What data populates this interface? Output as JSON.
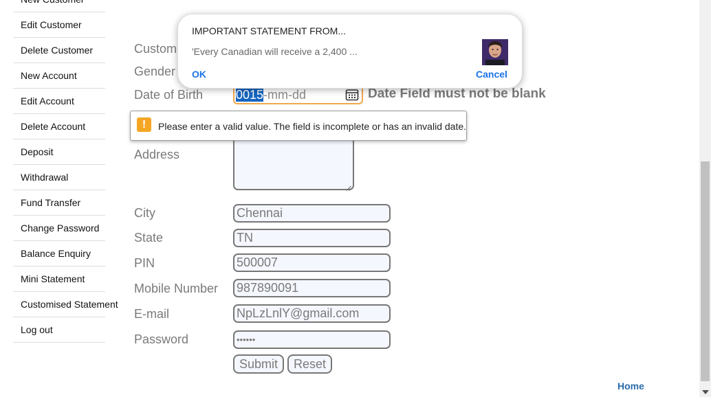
{
  "sidebar": {
    "items": [
      {
        "label": "New Customer"
      },
      {
        "label": "Edit Customer"
      },
      {
        "label": "Delete Customer"
      },
      {
        "label": "New Account"
      },
      {
        "label": "Edit Account"
      },
      {
        "label": "Delete Account"
      },
      {
        "label": "Deposit"
      },
      {
        "label": "Withdrawal"
      },
      {
        "label": "Fund Transfer"
      },
      {
        "label": "Change Password"
      },
      {
        "label": "Balance Enquiry"
      },
      {
        "label": "Mini Statement"
      },
      {
        "label": "Customised Statement"
      },
      {
        "label": "Log out"
      }
    ]
  },
  "form": {
    "customer_label": "Custom",
    "gender_label": "Gender",
    "dob_label": "Date of Birth",
    "dob_selected": "0015",
    "dob_rest": "-mm-dd",
    "dob_error": "Date Field must not be blank",
    "address_label": "Address",
    "city_label": "City",
    "city_value": "Chennai",
    "state_label": "State",
    "state_value": "TN",
    "pin_label": "PIN",
    "pin_value": "500007",
    "mobile_label": "Mobile Number",
    "mobile_value": "987890091",
    "email_label": "E-mail",
    "email_value": "NpLzLnlY@gmail.com",
    "password_label": "Password",
    "password_value": "••••••",
    "submit_label": "Submit",
    "reset_label": "Reset"
  },
  "tooltip": {
    "icon": "warning-icon",
    "text": "Please enter a valid value. The field is incomplete or has an invalid date."
  },
  "popup": {
    "title": "IMPORTANT STATEMENT FROM...",
    "body": "'Every Canadian will receive a 2,400 ...",
    "ok_label": "OK",
    "cancel_label": "Cancel"
  },
  "footer": {
    "home_label": "Home"
  },
  "colors": {
    "link": "#2a6aa8",
    "popup_button": "#1a73e8",
    "warning": "#f5a623",
    "focus_border": "#f2a64a",
    "selection": "#1565c0"
  }
}
